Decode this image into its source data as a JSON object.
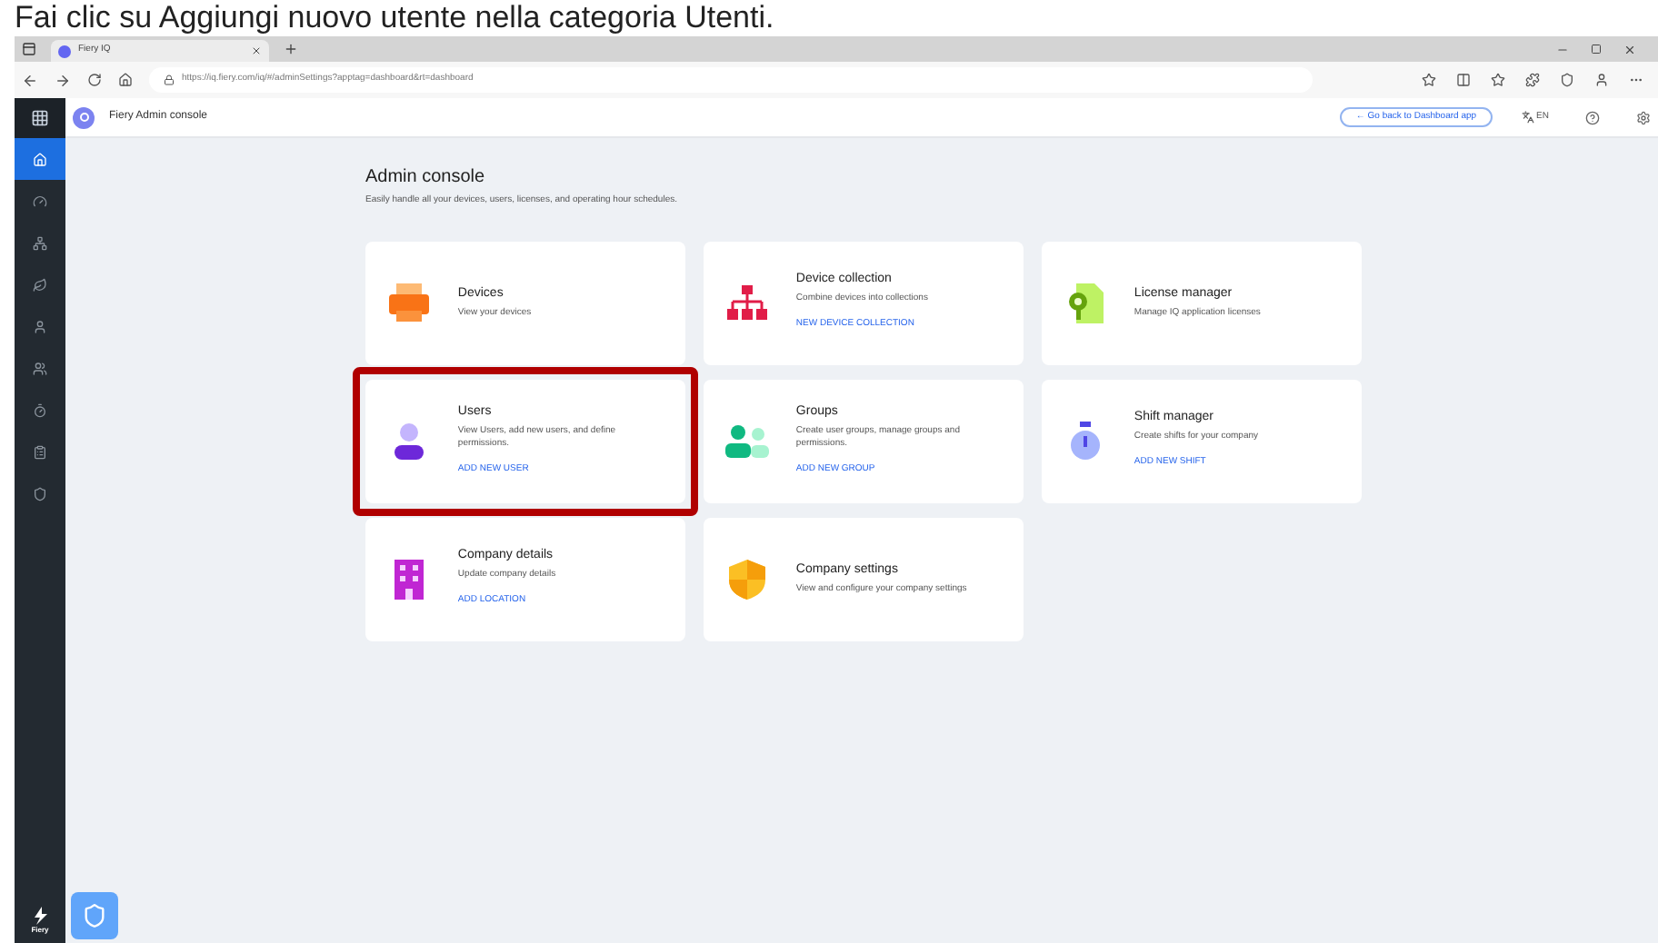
{
  "caption": "Fai clic su Aggiungi nuovo utente nella categoria Utenti.",
  "browser": {
    "tab_title": "Fiery IQ",
    "url": "https://iq.fiery.com/iq/#/adminSettings?apptag=dashboard&rt=dashboard"
  },
  "app": {
    "title": "Fiery Admin console",
    "back_button": "← Go back to Dashboard app",
    "language": "EN"
  },
  "sidebar": {
    "items": [
      {
        "kind": "home",
        "selected": true
      },
      {
        "kind": "gauge",
        "selected": false
      },
      {
        "kind": "network",
        "selected": false
      },
      {
        "kind": "leaf",
        "selected": false
      },
      {
        "kind": "user",
        "selected": false
      },
      {
        "kind": "users",
        "selected": false
      },
      {
        "kind": "timer",
        "selected": false
      },
      {
        "kind": "clipboard",
        "selected": false
      },
      {
        "kind": "shield",
        "selected": false
      }
    ],
    "logo": "Fiery"
  },
  "page": {
    "title": "Admin console",
    "subtitle": "Easily handle all your devices, users, licenses, and operating hour schedules.",
    "cards": [
      {
        "kind": "devices",
        "title": "Devices",
        "description": "View your devices",
        "highlighted": false
      },
      {
        "kind": "collection",
        "title": "Device collection",
        "description": "Combine devices into collections",
        "action": "NEW DEVICE COLLECTION",
        "highlighted": false
      },
      {
        "kind": "license",
        "title": "License manager",
        "description": "Manage IQ application licenses",
        "highlighted": false
      },
      {
        "kind": "users",
        "title": "Users",
        "description": "View Users, add new users, and define permissions.",
        "action": "ADD NEW USER",
        "highlighted": true
      },
      {
        "kind": "groups",
        "title": "Groups",
        "description": "Create user groups, manage groups and permissions.",
        "action": "ADD NEW GROUP",
        "highlighted": false
      },
      {
        "kind": "shift",
        "title": "Shift manager",
        "description": "Create shifts for your company",
        "action": "ADD NEW SHIFT",
        "highlighted": false
      },
      {
        "kind": "company",
        "title": "Company details",
        "description": "Update company details",
        "action": "ADD LOCATION",
        "highlighted": false
      },
      {
        "kind": "settings",
        "title": "Company settings",
        "description": "View and configure your company settings",
        "highlighted": false
      }
    ]
  }
}
